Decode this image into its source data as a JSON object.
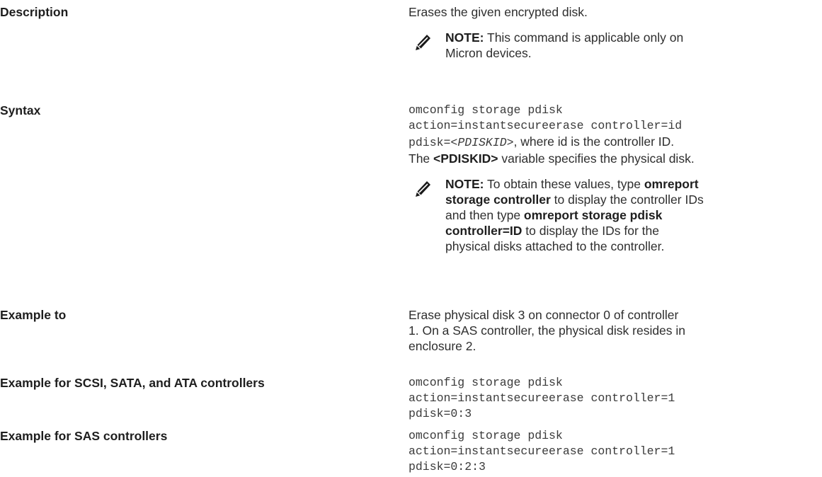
{
  "rows": {
    "description": {
      "label": "Description",
      "text": "Erases the given encrypted disk.",
      "note": {
        "prefix": "NOTE:",
        "line1": " This command is applicable only on",
        "line2": "Micron devices."
      }
    },
    "syntax": {
      "label": "Syntax",
      "code_line1": "omconfig storage pdisk",
      "code_line2": "action=instantsecureerase controller=id",
      "code_line3_prefix": "pdisk=<",
      "code_line3_var": "PDISKID",
      "code_line3_suffix": ">",
      "text_line3": ", where id is the controller ID.",
      "text_line4_a": "The ",
      "text_line4_bold": "<PDISKID>",
      "text_line4_b": " variable specifies the physical disk.",
      "note": {
        "prefix": "NOTE:",
        "l1_text": " To obtain these values, type ",
        "l1_bold": "omreport",
        "l2_bold": "storage controller",
        "l2_text": " to display the controller IDs",
        "l3_text": "and then type ",
        "l3_bold": "omreport storage pdisk",
        "l4_bold": "controller=ID",
        "l4_text": " to display the IDs for the",
        "l5_text": "physical disks attached to the controller."
      }
    },
    "example_to": {
      "label": "Example to",
      "line1": "Erase physical disk 3 on connector 0 of controller",
      "line2": "1. On a SAS controller, the physical disk resides in",
      "line3": "enclosure 2."
    },
    "example_scsi": {
      "label": "Example for SCSI, SATA, and ATA controllers",
      "code_line1": "omconfig storage pdisk",
      "code_line2": "action=instantsecureerase controller=1",
      "code_line3": "pdisk=0:3"
    },
    "example_sas": {
      "label": "Example for SAS controllers",
      "code_line1": "omconfig storage pdisk",
      "code_line2": "action=instantsecureerase controller=1",
      "code_line3": "pdisk=0:2:3"
    }
  },
  "icons": {
    "note": "pencil-note-icon"
  }
}
